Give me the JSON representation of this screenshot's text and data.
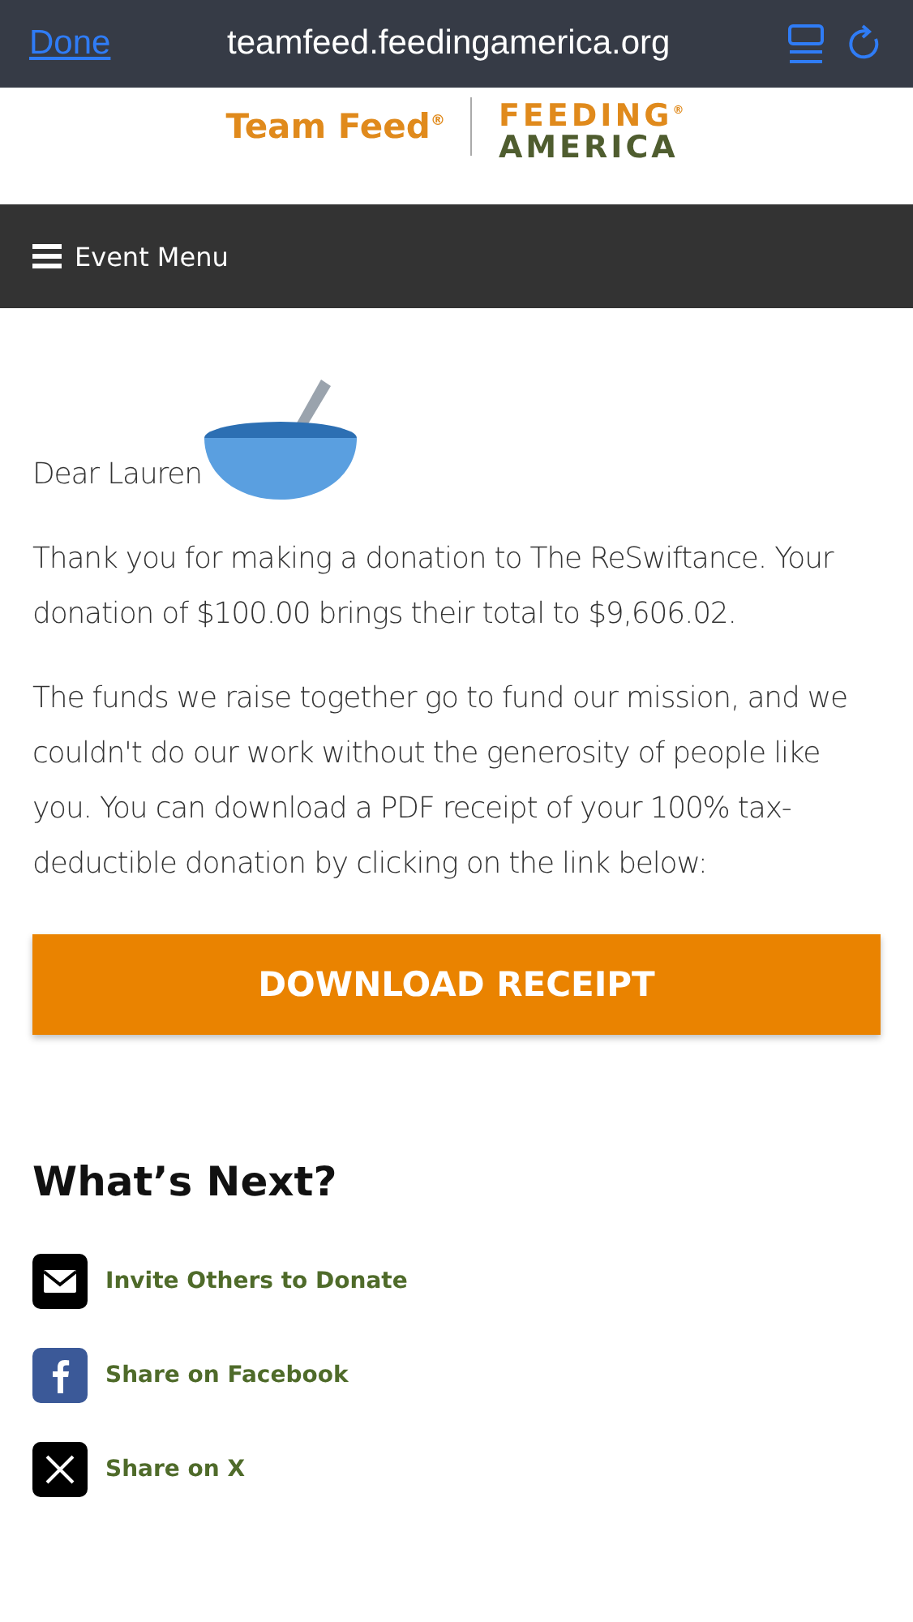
{
  "browser_bar": {
    "done": "Done",
    "url": "teamfeed.feedingamerica.org"
  },
  "logo": {
    "team_feed": "Team Feed$^{®}$",
    "feeding": "FEEDING$^{®}$",
    "america": "AMERICA"
  },
  "menu": {
    "label": "Event Menu"
  },
  "greeting": "Dear Lauren",
  "paragraphs": [
    "Thank you for making a donation to The ReSwiftance. Your donation of $100.00 brings their total to $9,606.02.",
    "The funds we raise together go to fund our mission, and we couldn't do our work without the generosity of people like you. You can download a PDF receipt of your 100% tax-deductible donation by clicking on the link below:"
  ],
  "button": "DOWNLOAD RECEIPT",
  "next_heading": "What’s Next?",
  "actions": [
    {
      "kind": "email",
      "label": "Invite Others to Donate"
    },
    {
      "kind": "facebook",
      "label": "Share on Facebook"
    },
    {
      "kind": "x",
      "label": "Share on X"
    }
  ]
}
